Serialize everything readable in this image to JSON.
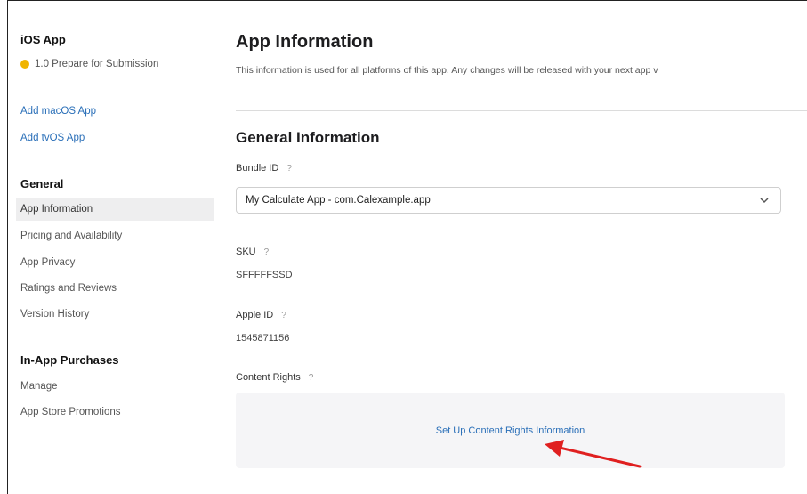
{
  "sidebar": {
    "app_name": "iOS App",
    "version_status": "1.0 Prepare for Submission",
    "add_links": [
      "Add macOS App",
      "Add tvOS App"
    ],
    "general_heading": "General",
    "general_items": [
      "App Information",
      "Pricing and Availability",
      "App Privacy",
      "Ratings and Reviews",
      "Version History"
    ],
    "selected_item": "App Information",
    "iap_heading": "In-App Purchases",
    "iap_items": [
      "Manage",
      "App Store Promotions"
    ]
  },
  "main": {
    "title": "App Information",
    "description": "This information is used for all platforms of this app. Any changes will be released with your next app v",
    "section_title": "General Information",
    "bundle_id": {
      "label": "Bundle ID",
      "help": "?",
      "value": "My Calculate App - com.Calexample.app"
    },
    "sku": {
      "label": "SKU",
      "help": "?",
      "value": "SFFFFFSSD"
    },
    "apple_id": {
      "label": "Apple ID",
      "help": "?",
      "value": "1545871156"
    },
    "content_rights": {
      "label": "Content Rights",
      "help": "?",
      "link": "Set Up Content Rights Information"
    }
  },
  "colors": {
    "link": "#2a6fb8",
    "status_dot": "#f0b400",
    "annotation_arrow": "#e02020",
    "panel_bg": "#f5f5f7"
  },
  "icons": [
    "status-dot",
    "help-icon",
    "chevron-down-icon",
    "annotation-arrow"
  ]
}
